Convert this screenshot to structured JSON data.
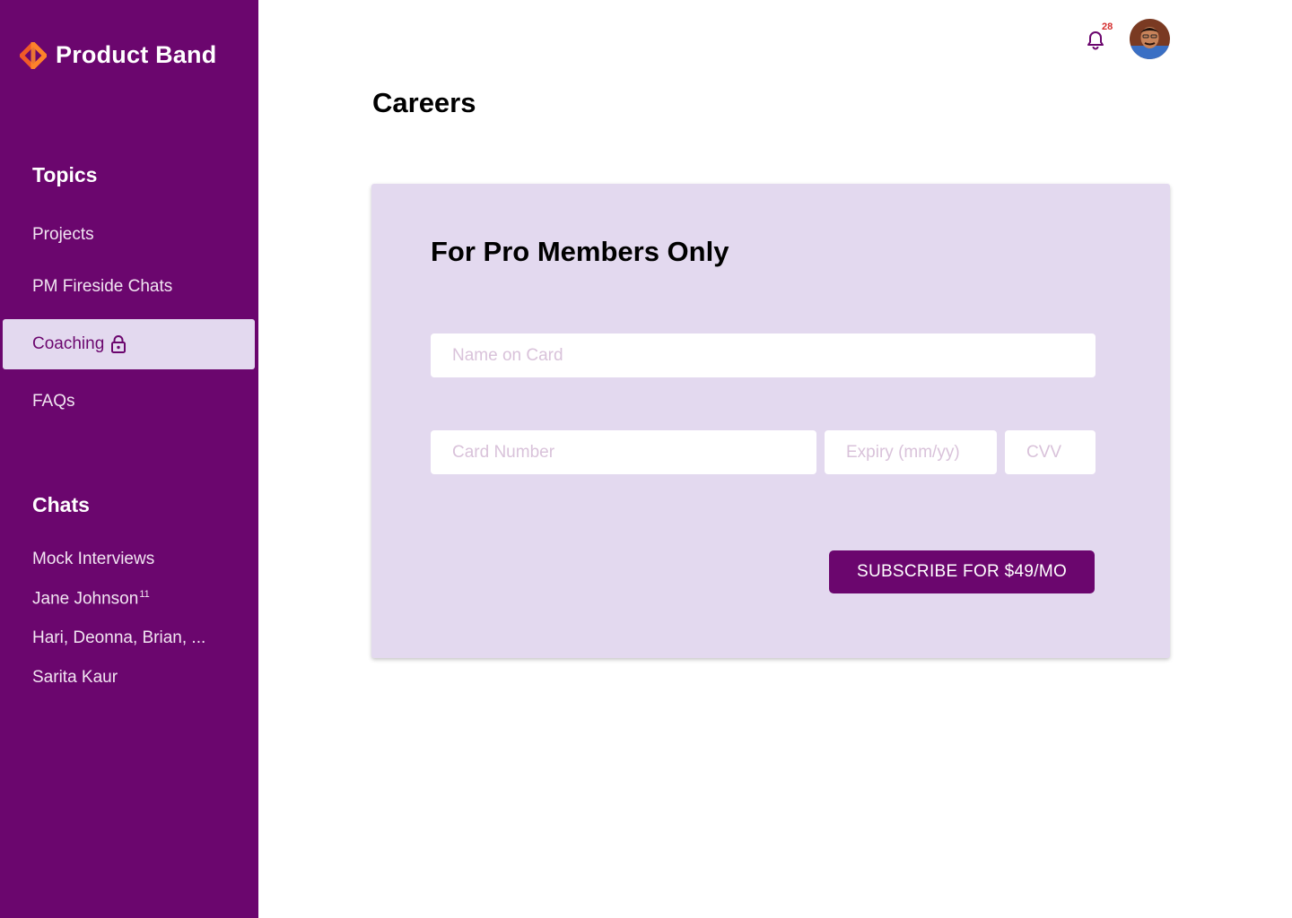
{
  "brand": {
    "name": "Product Band",
    "logo_icon": "diamond-logo-icon"
  },
  "colors": {
    "sidebar": "#6b066e",
    "card": "#e3d9ef",
    "accent": "#6b066e",
    "logo_orange": "#f05a28",
    "badge": "#d42d2d"
  },
  "sidebar": {
    "topics_heading": "Topics",
    "topics": [
      {
        "label": "Projects"
      },
      {
        "label": "PM Fireside Chats"
      },
      {
        "label": "Coaching",
        "locked": true,
        "active": true,
        "icon": "lock-icon"
      },
      {
        "label": "FAQs"
      }
    ],
    "chats_heading": "Chats",
    "chats": [
      {
        "label": "Mock Interviews"
      },
      {
        "label": "Jane Johnson",
        "badge": "11"
      },
      {
        "label": "Hari, Deonna, Brian, ..."
      },
      {
        "label": "Sarita Kaur"
      }
    ]
  },
  "header": {
    "notifications_count": "28",
    "bell_icon": "bell-icon",
    "avatar_icon": "user-avatar"
  },
  "main": {
    "title": "Careers",
    "card": {
      "title": "For Pro Members Only",
      "name_placeholder": "Name on Card",
      "card_number_placeholder": "Card Number",
      "expiry_placeholder": "Expiry (mm/yy)",
      "cvv_placeholder": "CVV",
      "subscribe_label": "SUBSCRIBE FOR $49/MO"
    }
  }
}
